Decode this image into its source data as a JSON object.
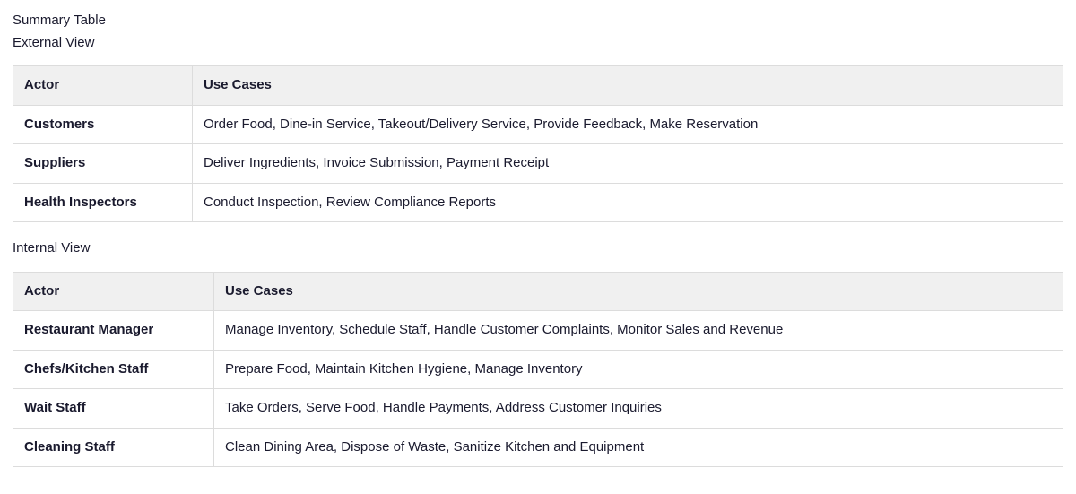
{
  "title": "Summary Table",
  "external": {
    "heading": "External View",
    "columns": [
      "Actor",
      "Use Cases"
    ],
    "rows": [
      {
        "actor": "Customers",
        "use_cases": "Order Food, Dine-in Service, Takeout/Delivery Service, Provide Feedback, Make Reservation"
      },
      {
        "actor": "Suppliers",
        "use_cases": "Deliver Ingredients, Invoice Submission, Payment Receipt"
      },
      {
        "actor": "Health Inspectors",
        "use_cases": "Conduct Inspection, Review Compliance Reports"
      }
    ]
  },
  "internal": {
    "heading": "Internal View",
    "columns": [
      "Actor",
      "Use Cases"
    ],
    "rows": [
      {
        "actor": "Restaurant Manager",
        "use_cases": "Manage Inventory, Schedule Staff, Handle Customer Complaints, Monitor Sales and Revenue"
      },
      {
        "actor": "Chefs/Kitchen Staff",
        "use_cases": "Prepare Food, Maintain Kitchen Hygiene, Manage Inventory"
      },
      {
        "actor": "Wait Staff",
        "use_cases": "Take Orders, Serve Food, Handle Payments, Address Customer Inquiries"
      },
      {
        "actor": "Cleaning Staff",
        "use_cases": "Clean Dining Area, Dispose of Waste, Sanitize Kitchen and Equipment"
      }
    ]
  }
}
